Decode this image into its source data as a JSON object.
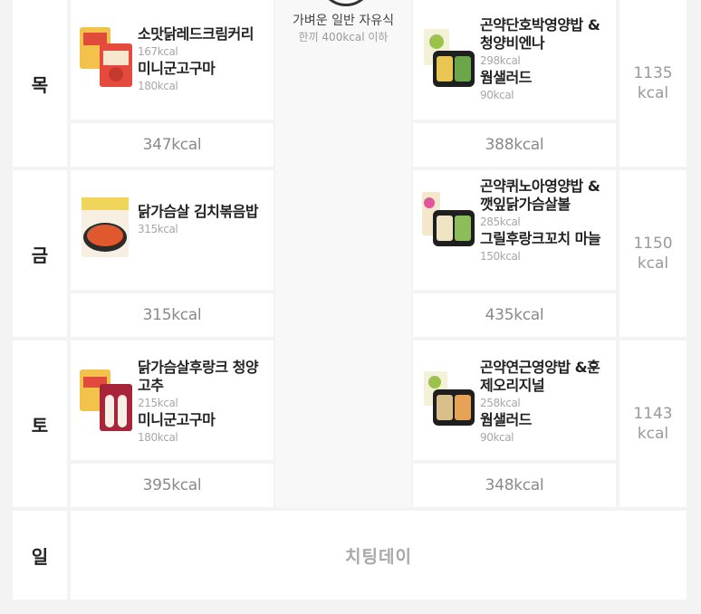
{
  "lunch": {
    "title": "가벼운 일반 자유식",
    "subtitle": "한끼 400kcal 이하"
  },
  "rows": [
    {
      "day": "목",
      "breakfast": {
        "items": [
          {
            "name": "소맛닭레드크림커리",
            "kcal": "167kcal"
          },
          {
            "name": "미니군고구마",
            "kcal": "180kcal"
          }
        ],
        "total": "347kcal"
      },
      "dinner": {
        "items": [
          {
            "name": "곤약단호박영양밥 &청양비엔나",
            "kcal": "298kcal"
          },
          {
            "name": "웜샐러드",
            "kcal": "90kcal"
          }
        ],
        "total": "388kcal"
      },
      "day_total": {
        "value": "1135",
        "unit": "kcal"
      }
    },
    {
      "day": "금",
      "breakfast": {
        "items": [
          {
            "name": "닭가슴살 김치볶음밥",
            "kcal": "315kcal"
          }
        ],
        "total": "315kcal"
      },
      "dinner": {
        "items": [
          {
            "name": "곤약퀴노아영양밥 &깻잎닭가슴살볼",
            "kcal": "285kcal"
          },
          {
            "name": "그릴후랑크꼬치 마늘",
            "kcal": "150kcal"
          }
        ],
        "total": "435kcal"
      },
      "day_total": {
        "value": "1150",
        "unit": "kcal"
      }
    },
    {
      "day": "토",
      "breakfast": {
        "items": [
          {
            "name": "닭가슴살후랑크 청양고추",
            "kcal": "215kcal"
          },
          {
            "name": "미니군고구마",
            "kcal": "180kcal"
          }
        ],
        "total": "395kcal"
      },
      "dinner": {
        "items": [
          {
            "name": "곤약연근영양밥 &훈제오리지널",
            "kcal": "258kcal"
          },
          {
            "name": "웜샐러드",
            "kcal": "90kcal"
          }
        ],
        "total": "348kcal"
      },
      "day_total": {
        "value": "1143",
        "unit": "kcal"
      }
    }
  ],
  "sunday": {
    "day": "일",
    "label": "치팅데이"
  },
  "colors": {
    "card": "#ffffff",
    "page": "#f3f3f3",
    "muted": "#9a9a9a"
  }
}
